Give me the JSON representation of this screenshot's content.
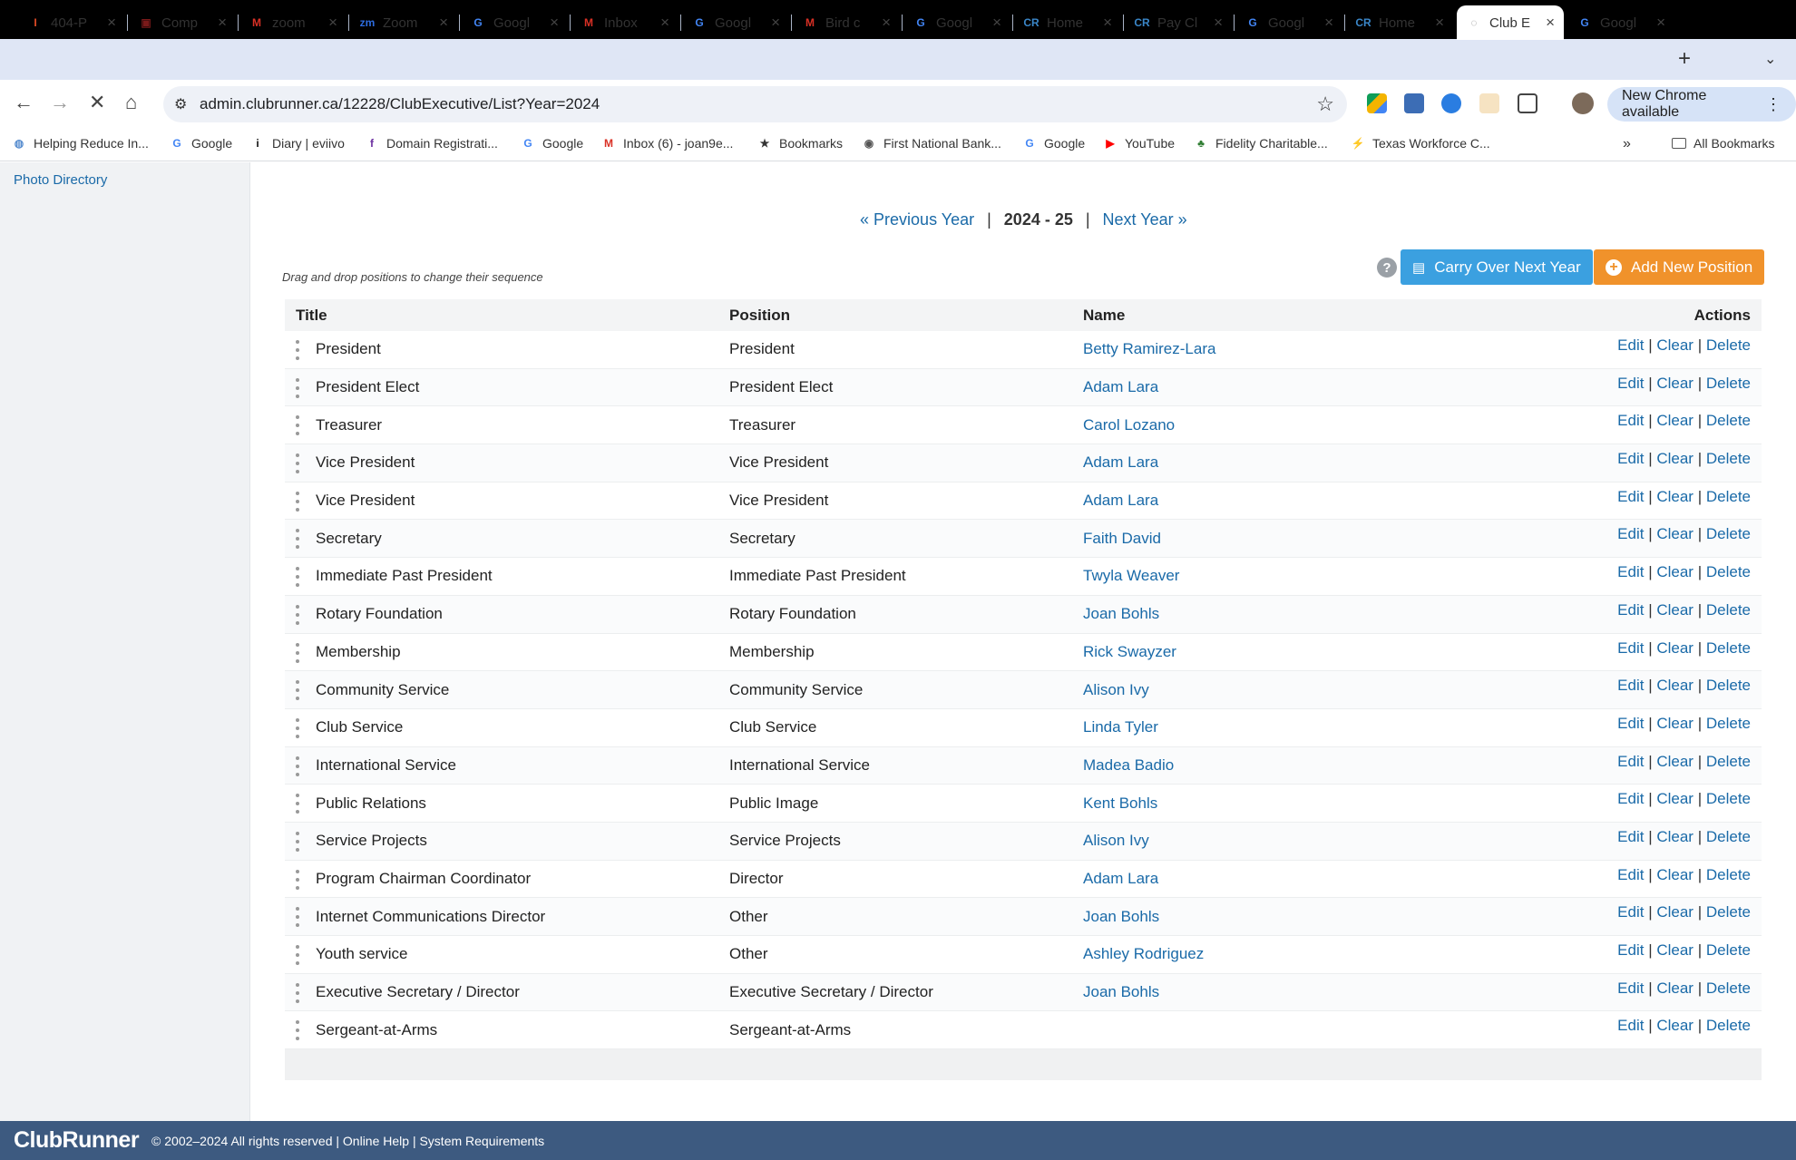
{
  "browser": {
    "tabs": [
      {
        "title": "404-P",
        "icon": "i-icon",
        "color": "#e34c26"
      },
      {
        "title": "Comp",
        "icon": "bank-icon",
        "color": "#7a1a1a"
      },
      {
        "title": "zoom",
        "icon": "gmail-icon",
        "color": "#d93025"
      },
      {
        "title": "Zoom",
        "icon": "zoom-icon",
        "color": "#2d6cdf"
      },
      {
        "title": "Googl",
        "icon": "google-icon",
        "color": "#4285f4"
      },
      {
        "title": "Inbox",
        "icon": "gmail-icon",
        "color": "#d93025"
      },
      {
        "title": "Googl",
        "icon": "google-icon",
        "color": "#4285f4"
      },
      {
        "title": "Bird c",
        "icon": "gmail-icon",
        "color": "#d93025"
      },
      {
        "title": "Googl",
        "icon": "google-icon",
        "color": "#4285f4"
      },
      {
        "title": "Home",
        "icon": "clubrunner-icon",
        "color": "#3a86c8"
      },
      {
        "title": "Pay Cl",
        "icon": "clubrunner-icon",
        "color": "#3a86c8"
      },
      {
        "title": "Googl",
        "icon": "google-icon",
        "color": "#4285f4"
      },
      {
        "title": "Home",
        "icon": "clubrunner-icon",
        "color": "#3a86c8"
      },
      {
        "title": "Club E",
        "icon": "loading-icon",
        "color": "#8a8a8a",
        "active": true
      },
      {
        "title": "Googl",
        "icon": "google-icon",
        "color": "#4285f4"
      }
    ],
    "url": "admin.clubrunner.ca/12228/ClubExecutive/List?Year=2024",
    "update_label": "New Chrome available",
    "bookmarks": [
      {
        "label": "Helping Reduce In...",
        "icon": "globe-icon"
      },
      {
        "label": "Google",
        "icon": "google-icon"
      },
      {
        "label": "Diary | eviivo",
        "icon": "diary-icon"
      },
      {
        "label": "Domain Registrati...",
        "icon": "domain-icon"
      },
      {
        "label": "Google",
        "icon": "google-icon"
      },
      {
        "label": "Inbox (6) - joan9e...",
        "icon": "gmail-icon"
      },
      {
        "label": "Bookmarks",
        "icon": "star-icon"
      },
      {
        "label": "First National Bank...",
        "icon": "bank-icon"
      },
      {
        "label": "Google",
        "icon": "google-icon"
      },
      {
        "label": "YouTube",
        "icon": "youtube-icon"
      },
      {
        "label": "Fidelity Charitable...",
        "icon": "fidelity-icon"
      },
      {
        "label": "Texas Workforce C...",
        "icon": "twc-icon"
      }
    ],
    "all_bookmarks": "All Bookmarks"
  },
  "sidebar": {
    "link": "Photo Directory"
  },
  "page": {
    "prev_year": "Previous Year",
    "current_year": "2024 - 25",
    "next_year": "Next Year",
    "separator": "|",
    "drag_hint": "Drag and drop positions to change their sequence",
    "help": "?",
    "carry_over": "Carry Over Next Year",
    "add_position": "Add New Position"
  },
  "table": {
    "headers": {
      "title": "Title",
      "position": "Position",
      "name": "Name",
      "actions": "Actions"
    },
    "actions": {
      "edit": "Edit",
      "clear": "Clear",
      "delete": "Delete",
      "sep": "|"
    },
    "rows": [
      {
        "title": "President",
        "position": "President",
        "name": "Betty Ramirez-Lara"
      },
      {
        "title": "President Elect",
        "position": "President Elect",
        "name": "Adam Lara"
      },
      {
        "title": "Treasurer",
        "position": "Treasurer",
        "name": "Carol Lozano"
      },
      {
        "title": "Vice President",
        "position": "Vice President",
        "name": "Adam Lara"
      },
      {
        "title": "Vice President",
        "position": "Vice President",
        "name": "Adam Lara"
      },
      {
        "title": "Secretary",
        "position": "Secretary",
        "name": "Faith David"
      },
      {
        "title": "Immediate Past President",
        "position": "Immediate Past President",
        "name": "Twyla Weaver"
      },
      {
        "title": "Rotary Foundation",
        "position": "Rotary Foundation",
        "name": "Joan Bohls"
      },
      {
        "title": "Membership",
        "position": "Membership",
        "name": "Rick Swayzer"
      },
      {
        "title": "Community Service",
        "position": "Community Service",
        "name": "Alison Ivy"
      },
      {
        "title": "Club Service",
        "position": "Club Service",
        "name": "Linda Tyler"
      },
      {
        "title": "International Service",
        "position": "International Service",
        "name": "Madea Badio"
      },
      {
        "title": "Public Relations",
        "position": "Public Image",
        "name": "Kent Bohls"
      },
      {
        "title": "Service Projects",
        "position": "Service Projects",
        "name": "Alison Ivy"
      },
      {
        "title": "Program Chairman Coordinator",
        "position": "Director",
        "name": "Adam Lara"
      },
      {
        "title": "Internet Communications Director",
        "position": "Other",
        "name": "Joan Bohls"
      },
      {
        "title": "Youth service",
        "position": "Other",
        "name": "Ashley Rodriguez"
      },
      {
        "title": "Executive Secretary / Director",
        "position": "Executive Secretary / Director",
        "name": "Joan Bohls"
      },
      {
        "title": "Sergeant-at-Arms",
        "position": "Sergeant-at-Arms",
        "name": ""
      }
    ]
  },
  "footer": {
    "logo": "ClubRunner",
    "copyright": "© 2002–2024  All rights reserved | Online Help | System Requirements"
  }
}
